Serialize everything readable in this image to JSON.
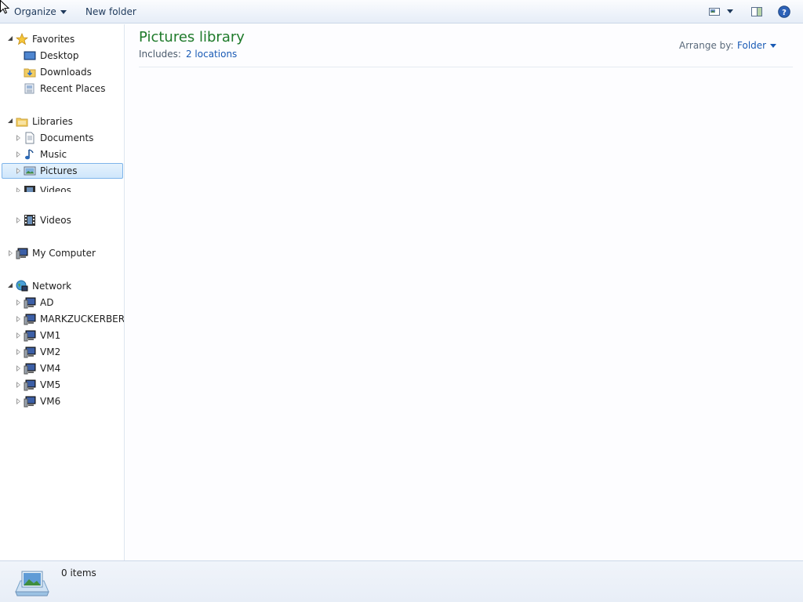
{
  "toolbar": {
    "organize_label": "Organize",
    "new_folder_label": "New folder",
    "views_icon": "change-view-icon",
    "preview_icon": "preview-pane-icon",
    "help_icon": "help-icon"
  },
  "nav": {
    "favorites": {
      "label": "Favorites",
      "items": [
        "Desktop",
        "Downloads",
        "Recent Places"
      ]
    },
    "libraries": {
      "label": "Libraries",
      "items": [
        "Documents",
        "Music",
        "Pictures",
        "Videos"
      ],
      "selected": "Pictures"
    },
    "extra_videos": "Videos",
    "my_computer": "My Computer",
    "network": {
      "label": "Network",
      "items": [
        "AD",
        "MARKZUCKERBERG",
        "VM1",
        "VM2",
        "VM4",
        "VM5",
        "VM6"
      ]
    }
  },
  "content": {
    "title": "Pictures library",
    "includes_label": "Includes:",
    "includes_link": "2 locations",
    "arrange_label": "Arrange by:",
    "arrange_value": "Folder"
  },
  "status": {
    "item_count": "0 items"
  },
  "colors": {
    "title_green": "#1e7a2a",
    "link_blue": "#1a5bb5",
    "selection_border": "#7eb4ea"
  }
}
